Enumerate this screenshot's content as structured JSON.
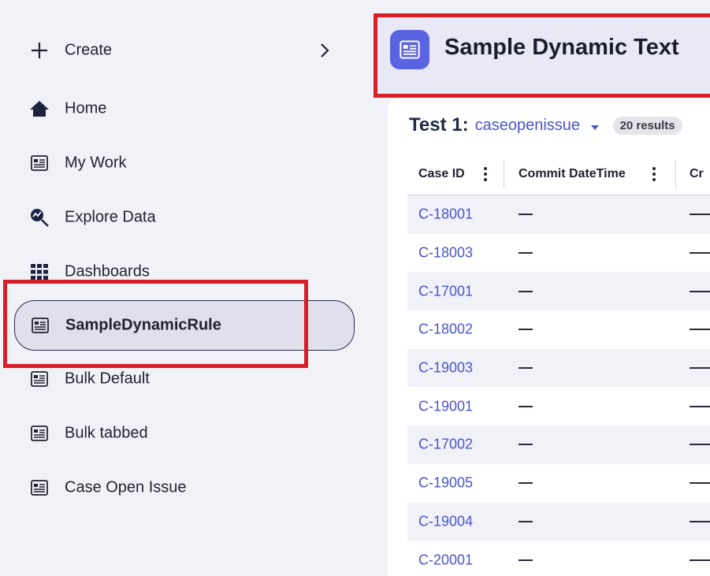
{
  "sidebar": {
    "items": [
      {
        "label": "Create",
        "icon": "plus-icon"
      },
      {
        "label": "Home",
        "icon": "home-icon"
      },
      {
        "label": "My Work",
        "icon": "document-icon"
      },
      {
        "label": "Explore Data",
        "icon": "explore-icon"
      },
      {
        "label": "Dashboards",
        "icon": "grid-icon"
      },
      {
        "label": "SampleDynamicRule",
        "icon": "document-icon",
        "active": true
      },
      {
        "label": "Bulk Default",
        "icon": "document-icon"
      },
      {
        "label": "Bulk tabbed",
        "icon": "document-icon"
      },
      {
        "label": "Case Open Issue",
        "icon": "document-icon"
      }
    ]
  },
  "header": {
    "title": "Sample Dynamic Text",
    "icon": "document-icon"
  },
  "results": {
    "test_label": "Test 1:",
    "source": "caseopenissue",
    "count": "20 results"
  },
  "table": {
    "columns": [
      "Case ID",
      "Commit DateTime",
      "Cr"
    ],
    "rows": [
      {
        "case_id": "C-18001",
        "commit": "—"
      },
      {
        "case_id": "C-18003",
        "commit": "—"
      },
      {
        "case_id": "C-17001",
        "commit": "—"
      },
      {
        "case_id": "C-18002",
        "commit": "—"
      },
      {
        "case_id": "C-19003",
        "commit": "—"
      },
      {
        "case_id": "C-19001",
        "commit": "—"
      },
      {
        "case_id": "C-17002",
        "commit": "—"
      },
      {
        "case_id": "C-19005",
        "commit": "—"
      },
      {
        "case_id": "C-19004",
        "commit": "—"
      },
      {
        "case_id": "C-20001",
        "commit": "—"
      }
    ]
  },
  "colors": {
    "accent": "#4a55c8",
    "header_icon_bg": "#5a63e0",
    "highlight": "#d61f26",
    "sidebar_bg": "#f1f1f8"
  }
}
